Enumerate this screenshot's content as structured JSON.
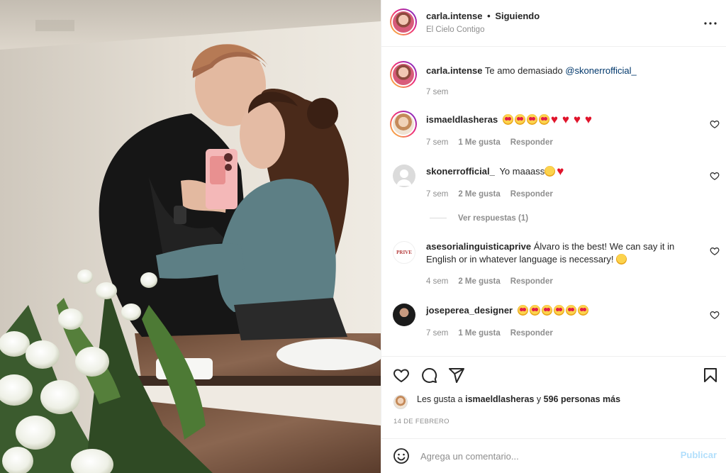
{
  "post": {
    "author": "carla.intense",
    "separator": "•",
    "follow_status": "Siguiendo",
    "location": "El Cielo Contigo",
    "more_icon": "more-options-icon"
  },
  "caption": {
    "username": "carla.intense",
    "text": "Te amo demasiado",
    "mention": "@skonerrofficial_",
    "time": "7 sem"
  },
  "comments": [
    {
      "username": "ismaeldlasheras",
      "emojis": [
        "star",
        "star",
        "star",
        "star",
        "heart",
        "heart",
        "heart",
        "heart"
      ],
      "time": "7 sem",
      "likes": "1 Me gusta",
      "reply": "Responder"
    },
    {
      "username": "skonerrofficial_",
      "text": "Yo maaass",
      "emojis": [
        "sad",
        "heart"
      ],
      "time": "7 sem",
      "likes": "2 Me gusta",
      "reply": "Responder"
    },
    {
      "username": "asesorialinguisticaprive",
      "text": "Álvaro is the best! We can say it in English or in whatever language is necessary!",
      "emojis": [
        "laugh"
      ],
      "time": "4 sem",
      "likes": "2 Me gusta",
      "reply": "Responder"
    },
    {
      "username": "joseperea_designer",
      "emojis": [
        "star",
        "star",
        "star",
        "star",
        "star",
        "star"
      ],
      "time": "7 sem",
      "likes": "1 Me gusta",
      "reply": "Responder"
    }
  ],
  "view_replies": "Ver respuestas (1)",
  "likes": {
    "prefix": "Les gusta a",
    "user": "ismaeldlasheras",
    "joiner": "y",
    "others": "596 personas más"
  },
  "date": "14 DE FEBRERO",
  "add_comment": {
    "placeholder": "Agrega un comentario...",
    "publish": "Publicar"
  },
  "asesoria_logo_text": "PRIVE",
  "colors": {
    "mention": "#00376b",
    "muted": "#8e8e8e",
    "publish_disabled": "#b2dffc",
    "heart": "#e0142b"
  }
}
